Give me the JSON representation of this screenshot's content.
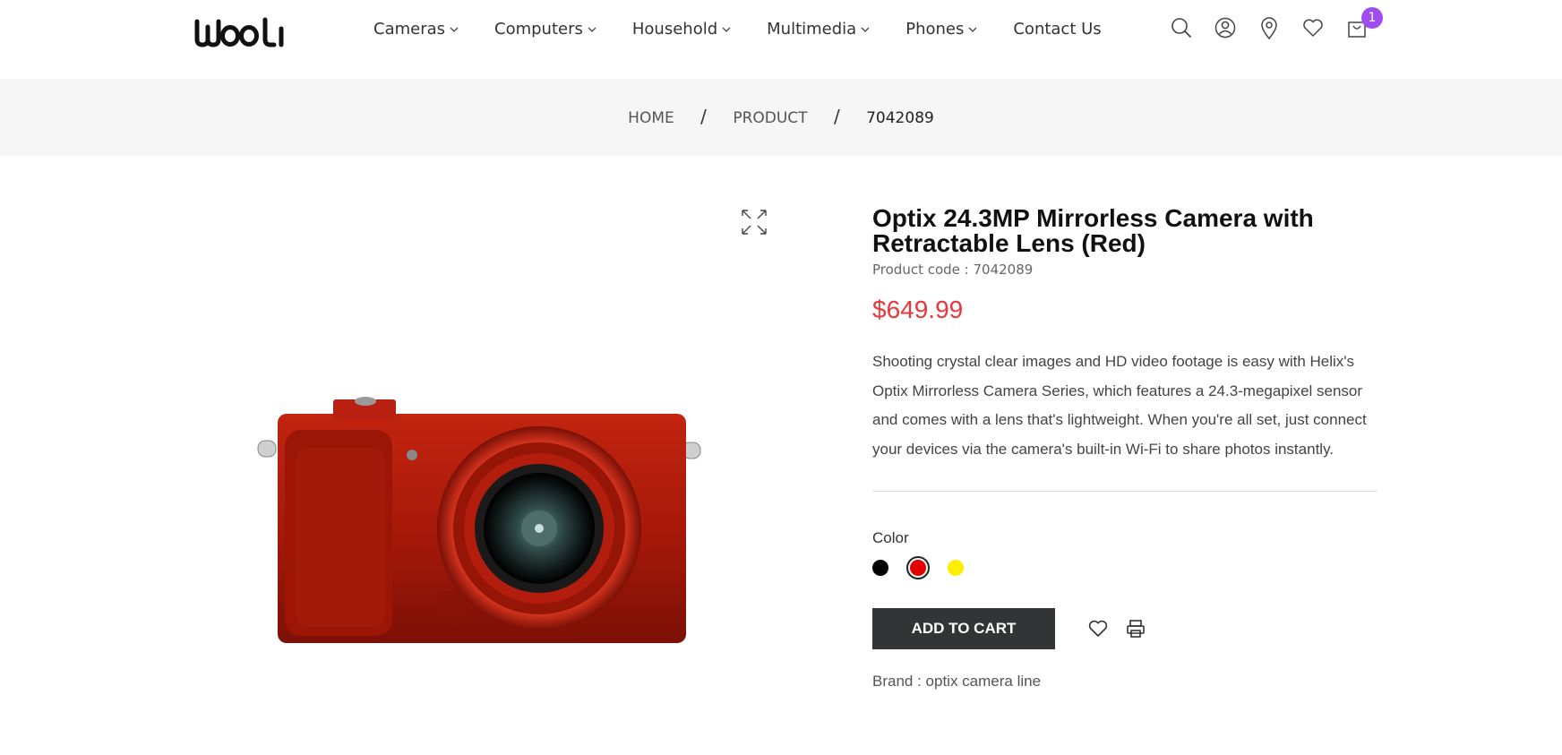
{
  "header": {
    "nav": [
      {
        "label": "Cameras",
        "dropdown": true
      },
      {
        "label": "Computers",
        "dropdown": true
      },
      {
        "label": "Household",
        "dropdown": true
      },
      {
        "label": "Multimedia",
        "dropdown": true
      },
      {
        "label": "Phones",
        "dropdown": true
      },
      {
        "label": "Contact Us",
        "dropdown": false
      }
    ],
    "icons": [
      "search-icon",
      "account-icon",
      "location-pin-icon",
      "heart-icon",
      "cart-icon"
    ],
    "cart_count": "1",
    "badge_color": "#a04df0"
  },
  "breadcrumb": {
    "home": "HOME",
    "product": "PRODUCT",
    "current": "7042089",
    "separator": "/"
  },
  "product": {
    "title": "Optix 24.3MP Mirrorless Camera with Retractable Lens (Red)",
    "code": "Product code : 7042089",
    "price": "$649.99",
    "price_color": "#e8363b",
    "description": "Shooting crystal clear images and HD video footage is easy with Helix's Optix Mirrorless Camera Series, which features a 24.3-megapixel sensor and comes with a lens that's lightweight. When you're all set, just connect your devices via the camera's built-in Wi-Fi to share photos instantly.",
    "color_label": "Color",
    "colors": [
      {
        "name": "black",
        "hex": "#000000",
        "selected": false
      },
      {
        "name": "red",
        "hex": "#e00000",
        "selected": true
      },
      {
        "name": "yellow",
        "hex": "#ffee00",
        "selected": false
      }
    ],
    "add_to_cart": "ADD TO CART",
    "brand": "Brand : optix camera line"
  }
}
